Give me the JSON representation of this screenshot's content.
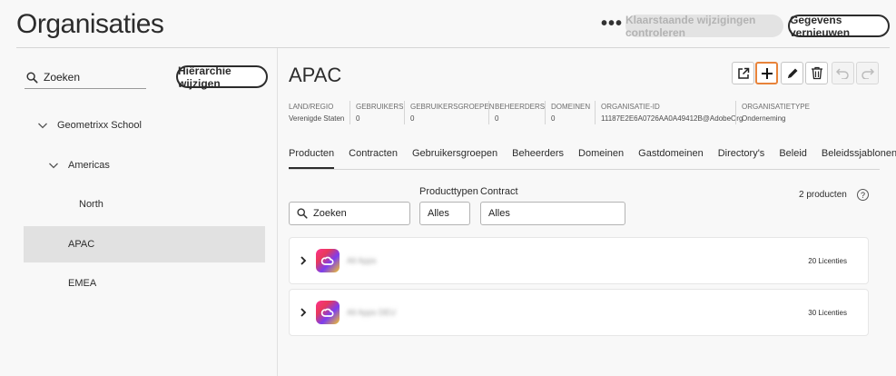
{
  "header": {
    "title": "Organisaties",
    "more_label": "•••",
    "review_label": "Klaarstaande wijzigingen controleren",
    "refresh_label": "Gegevens vernieuwen"
  },
  "sidebar": {
    "search_placeholder": "Zoeken",
    "hierarchy_label": "Hiërarchie wijzigen",
    "tree": [
      {
        "label": "Geometrixx School"
      },
      {
        "label": "Americas"
      },
      {
        "label": "North"
      },
      {
        "label": "APAC"
      },
      {
        "label": "EMEA"
      }
    ]
  },
  "org": {
    "name": "APAC",
    "meta": [
      {
        "label": "LAND/REGIO",
        "value": "Verenigde Staten"
      },
      {
        "label": "GEBRUIKERS",
        "value": "0"
      },
      {
        "label": "GEBRUIKERSGROEPEN",
        "value": "0"
      },
      {
        "label": "BEHEERDERS",
        "value": "0"
      },
      {
        "label": "DOMEINEN",
        "value": "0"
      },
      {
        "label": "ORGANISATIE-ID",
        "value": "11187E2E6A0726AA0A49412B@AdobeOrg"
      },
      {
        "label": "ORGANISATIETYPE",
        "value": "Onderneming"
      }
    ]
  },
  "tabs": [
    {
      "label": "Producten"
    },
    {
      "label": "Contracten"
    },
    {
      "label": "Gebruikersgroepen"
    },
    {
      "label": "Beheerders"
    },
    {
      "label": "Domeinen"
    },
    {
      "label": "Gastdomeinen"
    },
    {
      "label": "Directory's"
    },
    {
      "label": "Beleid"
    },
    {
      "label": "Beleidssjablonen"
    }
  ],
  "filters": {
    "search_placeholder": "Zoeken",
    "producttypes_label": "Producttypen",
    "producttypes_value": "Alles",
    "contract_label": "Contract",
    "contract_value": "Alles",
    "count": "2 producten",
    "help": "?"
  },
  "products": [
    {
      "name": "All Apps",
      "licenses": "20 Licenties"
    },
    {
      "name": "All Apps DEU",
      "licenses": "30 Licenties"
    }
  ],
  "colors": {
    "highlight": "#e8833a"
  }
}
